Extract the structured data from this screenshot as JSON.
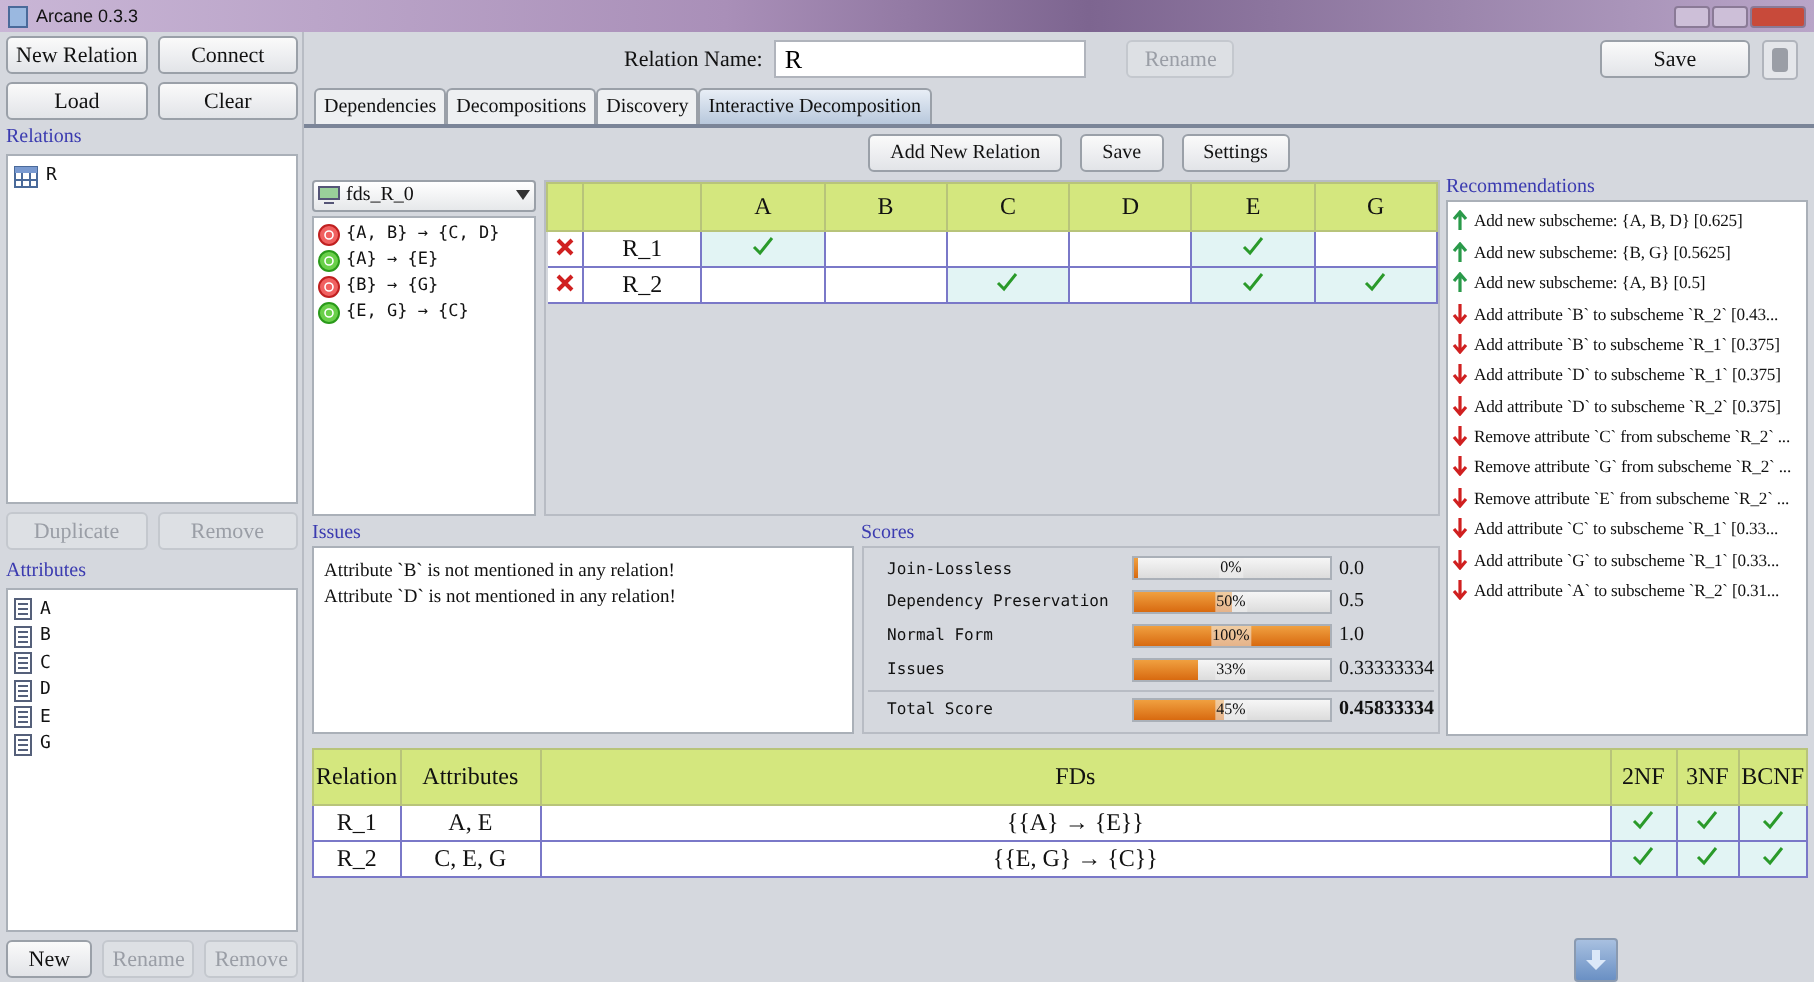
{
  "window": {
    "title": "Arcane 0.3.3"
  },
  "left_buttons": [
    {
      "label": "New Relation",
      "disabled": false
    },
    {
      "label": "Connect",
      "disabled": false
    },
    {
      "label": "Load",
      "disabled": false
    },
    {
      "label": "Clear",
      "disabled": false
    }
  ],
  "relations": {
    "title": "Relations",
    "items": [
      "R"
    ],
    "buttons": [
      {
        "label": "Duplicate",
        "disabled": true
      },
      {
        "label": "Remove",
        "disabled": true
      }
    ]
  },
  "attributes": {
    "title": "Attributes",
    "items": [
      "A",
      "B",
      "C",
      "D",
      "E",
      "G"
    ],
    "buttons": [
      {
        "label": "New",
        "disabled": false
      },
      {
        "label": "Rename",
        "disabled": true
      },
      {
        "label": "Remove",
        "disabled": true
      }
    ]
  },
  "relation_name": {
    "label": "Relation Name:",
    "value": "R",
    "rename": {
      "label": "Rename",
      "disabled": true
    },
    "save": "Save"
  },
  "tabs": [
    {
      "label": "Dependencies",
      "selected": false
    },
    {
      "label": "Decompositions",
      "selected": false
    },
    {
      "label": "Discovery",
      "selected": false
    },
    {
      "label": "Interactive Decomposition",
      "selected": true
    }
  ],
  "toolbar": [
    "Add New Relation",
    "Save",
    "Settings"
  ],
  "fd_set": {
    "selector": "fds_R_0",
    "items": [
      {
        "text": "{A, B} → {C, D}",
        "preserved": false
      },
      {
        "text": "{A} → {E}",
        "preserved": true
      },
      {
        "text": "{B} → {G}",
        "preserved": false
      },
      {
        "text": "{E, G} → {C}",
        "preserved": true
      }
    ]
  },
  "decomposition": {
    "columns": [
      "A",
      "B",
      "C",
      "D",
      "E",
      "G"
    ],
    "rows": [
      {
        "name": "R_1",
        "cells": [
          {
            "checked": true
          },
          {
            "checked": false
          },
          {
            "checked": false
          },
          {
            "checked": false
          },
          {
            "checked": true
          },
          {
            "checked": false
          }
        ]
      },
      {
        "name": "R_2",
        "cells": [
          {
            "checked": false
          },
          {
            "checked": false
          },
          {
            "checked": true
          },
          {
            "checked": false
          },
          {
            "checked": true
          },
          {
            "checked": true
          }
        ]
      }
    ]
  },
  "recommendations": {
    "title": "Recommendations",
    "items": [
      {
        "kind": "up",
        "text": "Add new subscheme: {A, B, D} [0.625]"
      },
      {
        "kind": "up",
        "text": "Add new subscheme: {B, G} [0.5625]"
      },
      {
        "kind": "up",
        "text": "Add new subscheme: {A, B} [0.5]"
      },
      {
        "kind": "down",
        "text": "Add attribute `B` to subscheme `R_2` [0.43..."
      },
      {
        "kind": "down",
        "text": "Add attribute `B` to subscheme `R_1` [0.375]"
      },
      {
        "kind": "down",
        "text": "Add attribute `D` to subscheme `R_1` [0.375]"
      },
      {
        "kind": "down",
        "text": "Add attribute `D` to subscheme `R_2` [0.375]"
      },
      {
        "kind": "down",
        "text": "Remove attribute `C` from subscheme `R_2` ..."
      },
      {
        "kind": "down",
        "text": "Remove attribute `G` from subscheme `R_2` ..."
      },
      {
        "kind": "down",
        "text": "Remove attribute `E` from subscheme `R_2` ..."
      },
      {
        "kind": "down",
        "text": "Add attribute `C` to subscheme `R_1` [0.33..."
      },
      {
        "kind": "down",
        "text": "Add attribute `G` to subscheme `R_1` [0.33..."
      },
      {
        "kind": "down",
        "text": "Add attribute `A` to subscheme `R_2` [0.31..."
      }
    ]
  },
  "issues": {
    "title": "Issues",
    "items": [
      "Attribute `B` is not mentioned in any relation!",
      "Attribute `D` is not mentioned in any relation!"
    ]
  },
  "scores": {
    "title": "Scores",
    "items": [
      {
        "name": "Join-Lossless",
        "level": 0,
        "percent": "0%",
        "value": "0.0"
      },
      {
        "name": "Dependency Preservation",
        "level": 0.5,
        "percent": "50%",
        "value": "0.5"
      },
      {
        "name": "Normal Form",
        "level": 1,
        "percent": "100%",
        "value": "1.0"
      },
      {
        "name": "Issues",
        "level": 0.33,
        "percent": "33%",
        "value": "0.33333334"
      }
    ],
    "total": {
      "name": "Total Score",
      "level": 0.46,
      "percent": "45%",
      "value": "0.45833334"
    }
  },
  "result_table": {
    "columns": [
      "Relation",
      "Attributes",
      "FDs",
      "2NF",
      "3NF",
      "BCNF"
    ],
    "rows": [
      {
        "relation": "R_1",
        "attributes": "A, E",
        "fds": "{{A} → {E}}",
        "forms": [
          {
            "checked": true
          },
          {
            "checked": true
          },
          {
            "checked": true
          }
        ]
      },
      {
        "relation": "R_2",
        "attributes": "C, E, G",
        "fds": "{{E, G} → {C}}",
        "forms": [
          {
            "checked": true
          },
          {
            "checked": true
          },
          {
            "checked": true
          }
        ]
      }
    ]
  }
}
